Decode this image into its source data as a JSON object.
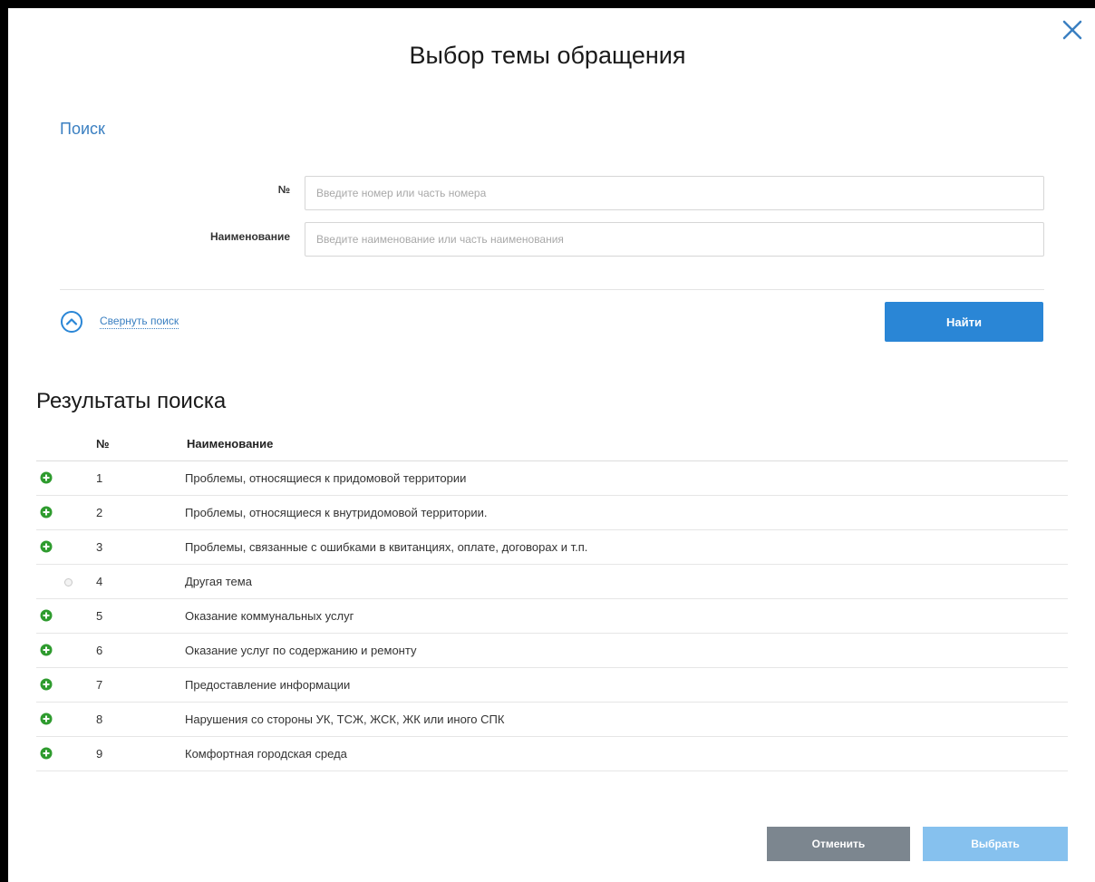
{
  "dialog": {
    "title": "Выбор темы обращения",
    "close_icon": "close-icon"
  },
  "search": {
    "heading": "Поиск",
    "number_label": "№",
    "number_placeholder": "Введите номер или часть номера",
    "number_value": "",
    "name_label": "Наименование",
    "name_placeholder": "Введите наименование или часть наименования",
    "name_value": "",
    "collapse_label": "Свернуть поиск",
    "collapse_icon": "chevron-up-circle-icon",
    "find_label": "Найти"
  },
  "results": {
    "heading": "Результаты поиска",
    "columns": {
      "number": "№",
      "name": "Наименование"
    },
    "rows": [
      {
        "number": "1",
        "name": "Проблемы, относящиеся к придомовой территории",
        "expandable": true
      },
      {
        "number": "2",
        "name": "Проблемы, относящиеся к внутридомовой территории.",
        "expandable": true
      },
      {
        "number": "3",
        "name": "Проблемы, связанные с ошибками в квитанциях, оплате, договорах и т.п.",
        "expandable": true
      },
      {
        "number": "4",
        "name": "Другая тема",
        "expandable": false
      },
      {
        "number": "5",
        "name": "Оказание коммунальных услуг",
        "expandable": true
      },
      {
        "number": "6",
        "name": "Оказание услуг по содержанию и ремонту",
        "expandable": true
      },
      {
        "number": "7",
        "name": "Предоставление информации",
        "expandable": true
      },
      {
        "number": "8",
        "name": "Нарушения со стороны УК, ТСЖ, ЖСК, ЖК или иного СПК",
        "expandable": true
      },
      {
        "number": "9",
        "name": "Комфортная городская среда",
        "expandable": true
      }
    ]
  },
  "footer": {
    "cancel_label": "Отменить",
    "select_label": "Выбрать"
  },
  "colors": {
    "accent": "#2a86d6",
    "link": "#3a7fc1",
    "expand_icon": "#2e9b2e",
    "cancel_button": "#7c868f",
    "select_button_disabled": "#86c1ee"
  }
}
